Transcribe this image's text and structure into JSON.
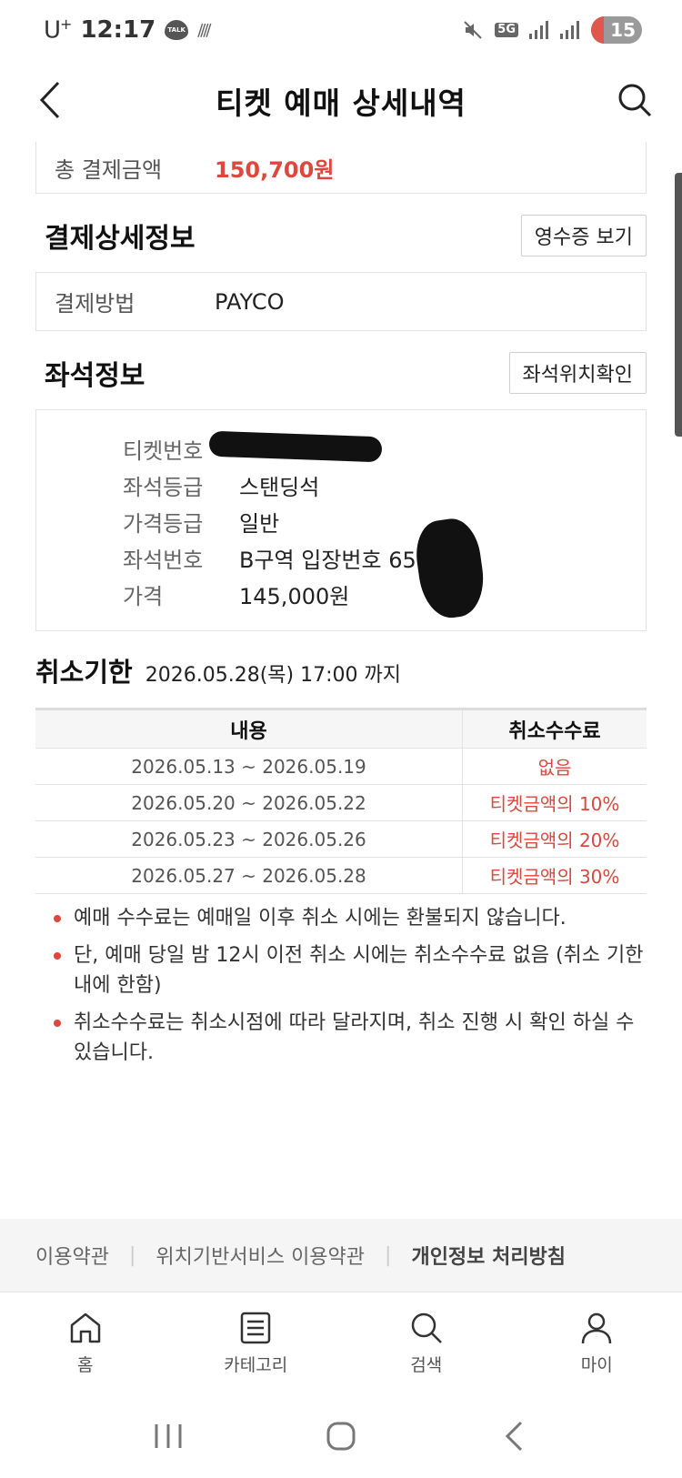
{
  "status_bar": {
    "carrier": "U",
    "carrier_sup": "+",
    "time": "12:17",
    "talk_badge": "TALK",
    "network": "5G",
    "battery": "15"
  },
  "header": {
    "title": "티켓 예매 상세내역"
  },
  "total": {
    "label": "총 결제금액",
    "amount": "150,700원"
  },
  "payment_detail": {
    "title": "결제상세정보",
    "receipt_button": "영수증 보기",
    "method_label": "결제방법",
    "method_value": "PAYCO"
  },
  "seat_info": {
    "title": "좌석정보",
    "location_button": "좌석위치확인",
    "rows": [
      {
        "label": "티켓번호",
        "value": ""
      },
      {
        "label": "좌석등급",
        "value": "스탠딩석"
      },
      {
        "label": "가격등급",
        "value": "일반"
      },
      {
        "label": "좌석번호",
        "value": "B구역 입장번호 65"
      },
      {
        "label": "가격",
        "value": "145,000원"
      }
    ]
  },
  "cancel": {
    "title": "취소기한",
    "deadline": "2026.05.28(목) 17:00 까지",
    "table_headers": {
      "period": "내용",
      "fee": "취소수수료"
    },
    "rows": [
      {
        "period": "2026.05.13 ~ 2026.05.19",
        "fee": "없음"
      },
      {
        "period": "2026.05.20 ~ 2026.05.22",
        "fee": "티켓금액의 10%"
      },
      {
        "period": "2026.05.23 ~ 2026.05.26",
        "fee": "티켓금액의 20%"
      },
      {
        "period": "2026.05.27 ~ 2026.05.28",
        "fee": "티켓금액의 30%"
      }
    ],
    "notes": [
      "예매 수수료는 예매일 이후 취소 시에는 환불되지 않습니다.",
      "단, 예매 당일 밤 12시 이전 취소 시에는 취소수수료 없음 (취소 기한 내에 한함)",
      "취소수수료는 취소시점에 따라 달라지며, 취소 진행 시 확인 하실 수 있습니다."
    ]
  },
  "footer": {
    "links": [
      "이용약관",
      "위치기반서비스 이용약관",
      "개인정보 처리방침"
    ]
  },
  "bottom_nav": [
    {
      "label": "홈",
      "icon": "home-icon"
    },
    {
      "label": "카테고리",
      "icon": "category-icon"
    },
    {
      "label": "검색",
      "icon": "search-icon"
    },
    {
      "label": "마이",
      "icon": "user-icon"
    }
  ],
  "colors": {
    "accent": "#e0463c",
    "border": "#e3e3e3"
  }
}
